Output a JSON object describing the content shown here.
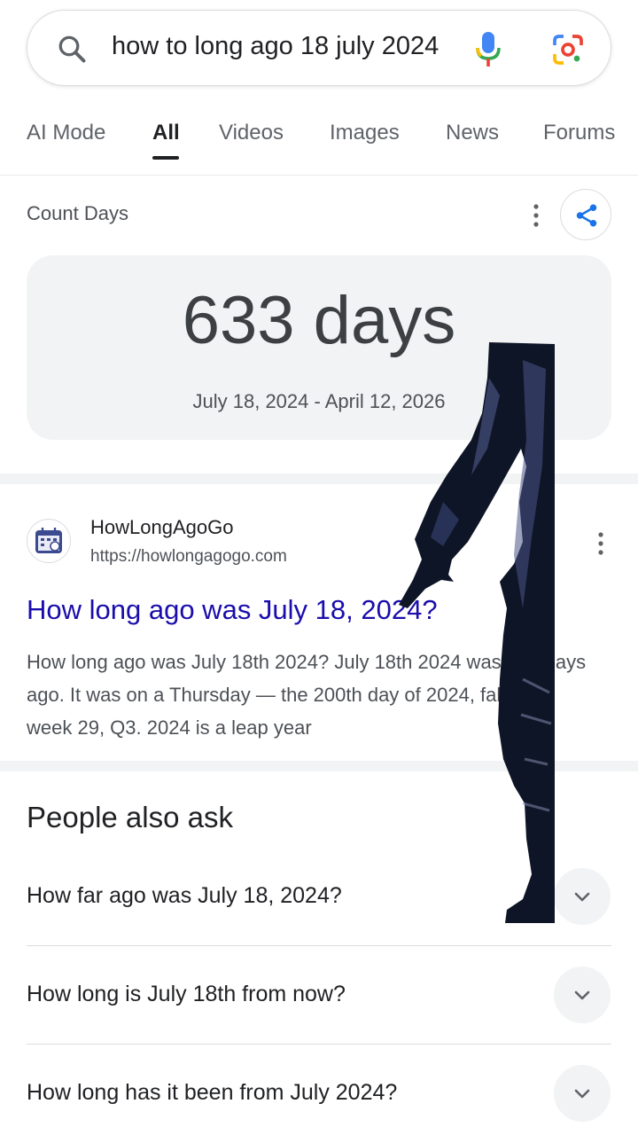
{
  "search": {
    "query": "how to long ago 18 july 2024",
    "icons": [
      "search-icon",
      "mic-icon",
      "lens-icon"
    ]
  },
  "tabs": [
    {
      "label": "AI Mode",
      "active": false
    },
    {
      "label": "All",
      "active": true
    },
    {
      "label": "Videos",
      "active": false
    },
    {
      "label": "Images",
      "active": false
    },
    {
      "label": "News",
      "active": false
    },
    {
      "label": "Forums",
      "active": false
    }
  ],
  "count_card": {
    "label": "Count Days",
    "value": "633 days",
    "range": "July 18, 2024 - April 12, 2026"
  },
  "result": {
    "site_name": "HowLongAgoGo",
    "site_url": "https://howlongagogo.com",
    "title": "How long ago was July 18, 2024?",
    "snippet": "How long ago was July 18th 2024? July 18th 2024 was 632 days ago. It was on a Thursday — the 200th day of 2024, falling in week 29, Q3. 2024 is a leap year"
  },
  "people_also_ask": {
    "title": "People also ask",
    "questions": [
      "How far ago was July 18, 2024?",
      "How long is July 18th from now?",
      "How long has it been from July 2024?"
    ]
  },
  "colors": {
    "link": "#1a0dab",
    "accent_blue": "#1a73e8",
    "surface": "#f1f3f4"
  }
}
